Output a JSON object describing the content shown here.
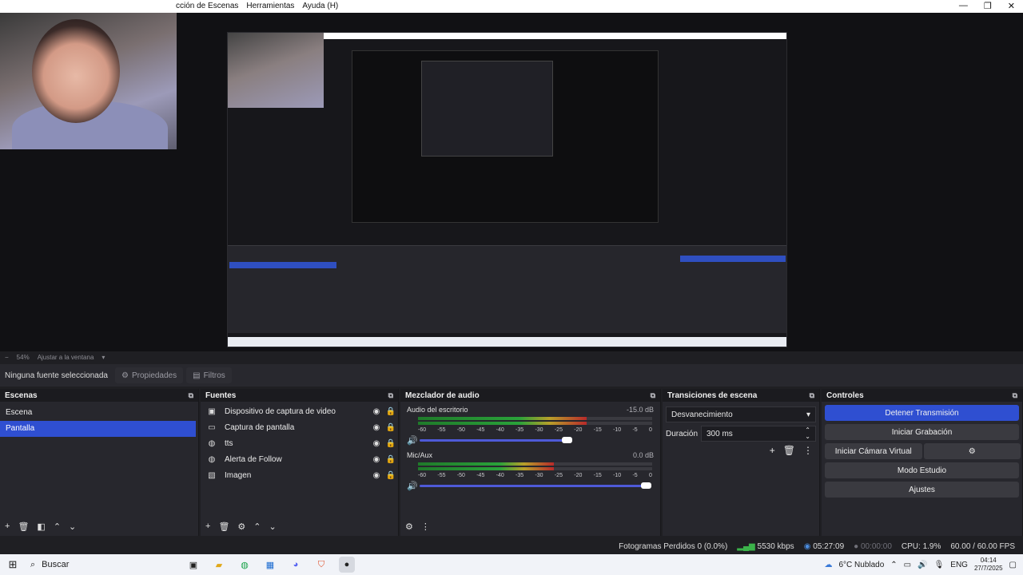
{
  "menu": {
    "items": [
      "cción de Escenas",
      "Herramientas",
      "Ayuda (H)"
    ],
    "window_controls": [
      "—",
      "❐",
      "✕"
    ]
  },
  "zoom": {
    "minus": "−",
    "level": "54%",
    "fit": "Ajustar a la ventana"
  },
  "source_bar": {
    "no_selection": "Ninguna fuente seleccionada",
    "properties": "Propiedades",
    "filters": "Filtros"
  },
  "scenes": {
    "title": "Escenas",
    "items": [
      {
        "label": "Escena"
      },
      {
        "label": "Pantalla",
        "selected": true
      }
    ]
  },
  "sources": {
    "title": "Fuentes",
    "items": [
      {
        "icon": "video-capture-icon",
        "glyph": "▣",
        "label": "Dispositivo de captura de video"
      },
      {
        "icon": "monitor-icon",
        "glyph": "▭",
        "label": "Captura de pantalla"
      },
      {
        "icon": "globe-icon",
        "glyph": "◍",
        "label": "tts"
      },
      {
        "icon": "globe-icon",
        "glyph": "◍",
        "label": "Alerta de Follow"
      },
      {
        "icon": "image-icon",
        "glyph": "▧",
        "label": "Imagen"
      }
    ]
  },
  "mixer": {
    "title": "Mezclador de audio",
    "scale": [
      "-60",
      "-55",
      "-50",
      "-45",
      "-40",
      "-35",
      "-30",
      "-25",
      "-20",
      "-15",
      "-10",
      "-5",
      "0"
    ],
    "channels": [
      {
        "name": "Audio del escritorio",
        "db": "-15.0 dB",
        "level": 0.72,
        "volume": 0.66
      },
      {
        "name": "Mic/Aux",
        "db": "0.0 dB",
        "level": 0.58,
        "volume": 1.0
      }
    ]
  },
  "transitions": {
    "title": "Transiciones de escena",
    "selected": "Desvanecimiento",
    "duration_label": "Duración",
    "duration_value": "300 ms"
  },
  "controls": {
    "title": "Controles",
    "stop_streaming": "Detener Transmisión",
    "start_recording": "Iniciar Grabación",
    "start_virtual_cam": "Iniciar Cámara Virtual",
    "studio_mode": "Modo Estudio",
    "settings": "Ajustes"
  },
  "status": {
    "dropped_frames": "Fotogramas Perdidos 0 (0.0%)",
    "bitrate": "5530 kbps",
    "stream_time": "05:27:09",
    "rec_time": "00:00:00",
    "cpu": "CPU: 1.9%",
    "fps": "60.00 / 60.00 FPS"
  },
  "taskbar": {
    "search": "Buscar",
    "weather": "6°C  Nublado",
    "lang": "ENG",
    "time": "04:14",
    "date": "27/7/2025"
  },
  "colors": {
    "accent": "#2f4fd1",
    "dock_bg": "#27272d",
    "meter_green": "#2aa23a"
  }
}
